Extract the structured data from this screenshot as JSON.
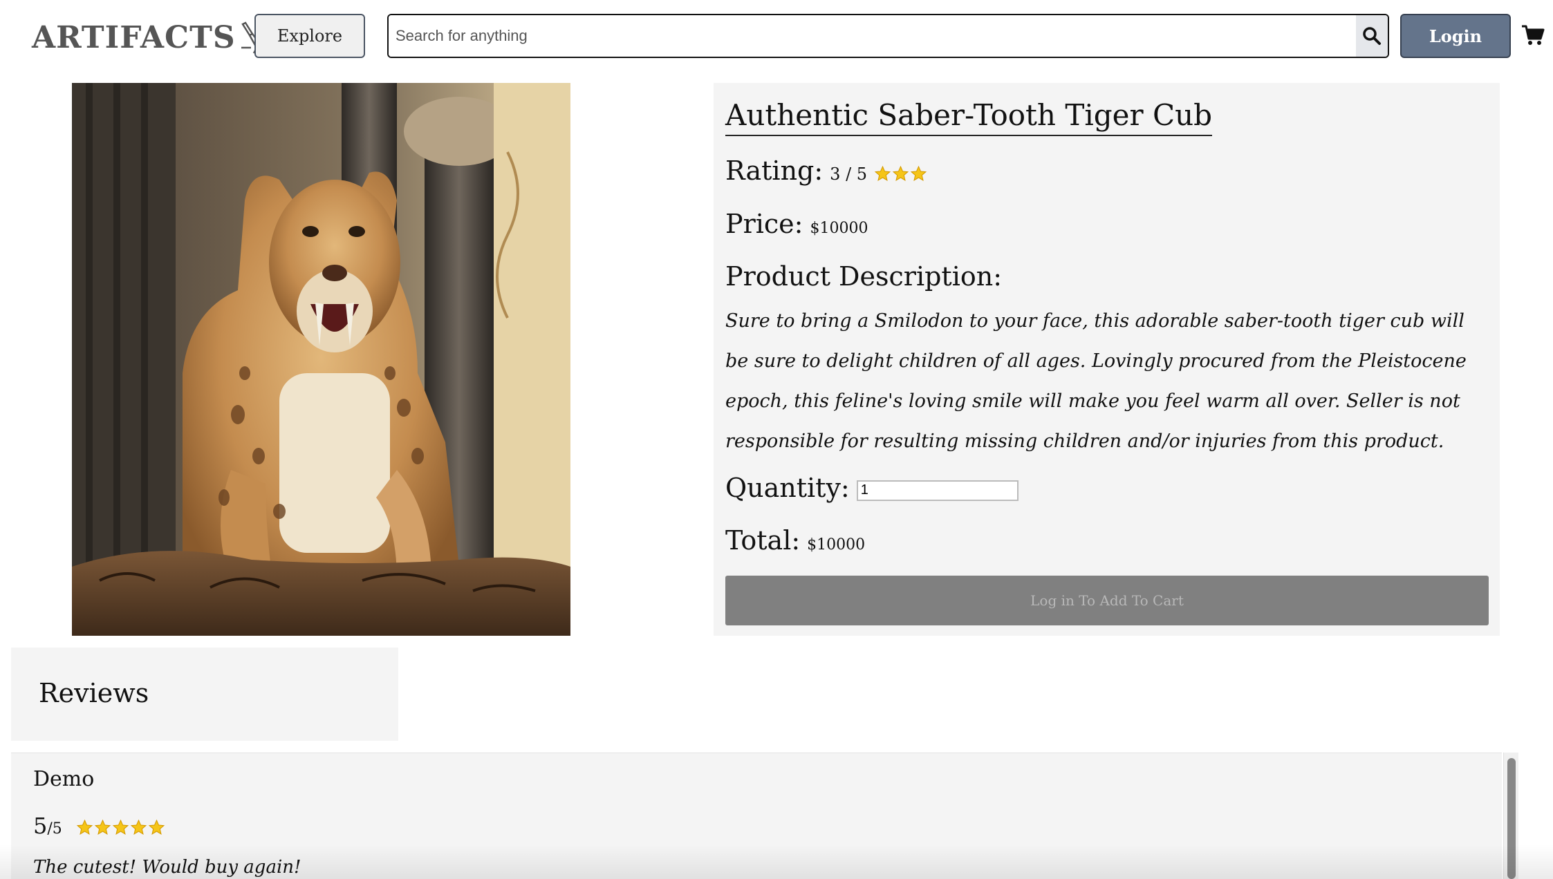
{
  "header": {
    "logo_text": "ARTIFACTS",
    "logo_icon": "archaeology-brush-icon",
    "explore_label": "Explore",
    "search_placeholder": "Search for anything",
    "search_icon": "search-icon",
    "login_label": "Login",
    "cart_icon": "shopping-cart-icon"
  },
  "product": {
    "image_alt": "saber-tooth tiger cub photo",
    "title": "Authentic Saber-Tooth Tiger Cub",
    "rating_label": "Rating:",
    "rating_value": "3 / 5",
    "rating_stars": 3,
    "price_label": "Price:",
    "price_value": "$10000",
    "description_label": "Product Description:",
    "description": "Sure to bring a Smilodon to your face, this adorable saber-tooth tiger cub will be sure to delight children of all ages. Lovingly procured from the Pleistocene epoch, this feline's loving smile will make you feel warm all over. Seller is not responsible for resulting missing children and/or injuries from this product.",
    "quantity_label": "Quantity:",
    "quantity_value": "1",
    "total_label": "Total:",
    "total_value": "$10000",
    "add_to_cart_label": "Log in To Add To Cart"
  },
  "reviews": {
    "heading": "Reviews",
    "items": [
      {
        "author": "Demo",
        "score": "5",
        "score_max": "/5",
        "stars": 5,
        "text": "The cutest! Would buy again!"
      }
    ]
  },
  "colors": {
    "panel_bg": "#f4f4f4",
    "login_bg": "#64748b",
    "cart_btn_bg": "#808080",
    "star": "#f5c518"
  }
}
